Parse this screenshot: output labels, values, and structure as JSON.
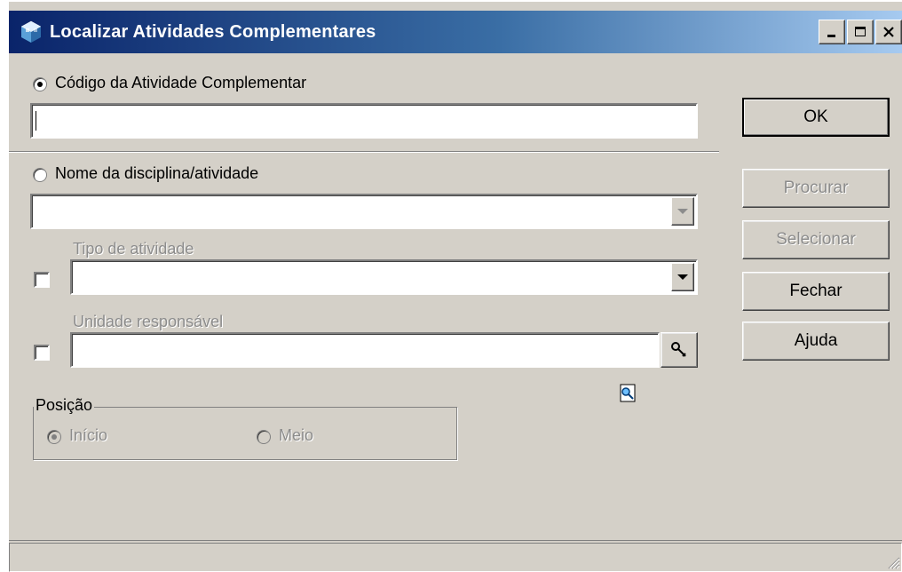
{
  "window": {
    "title": "Localizar Atividades Complementares",
    "icon": "app-cube-icon"
  },
  "options": {
    "codigo_label": "Código da Atividade Complementar",
    "codigo_value": "",
    "nome_label": "Nome da disciplina/atividade",
    "nome_value": "",
    "tipo_label": "Tipo de atividade",
    "tipo_value": "",
    "unidade_label": "Unidade responsável",
    "unidade_value": ""
  },
  "posicao": {
    "title": "Posição",
    "inicio_label": "Início",
    "meio_label": "Meio",
    "selected": "Início"
  },
  "buttons": {
    "ok": "OK",
    "procurar": "Procurar",
    "selecionar": "Selecionar",
    "fechar": "Fechar",
    "ajuda": "Ajuda"
  },
  "status": ""
}
